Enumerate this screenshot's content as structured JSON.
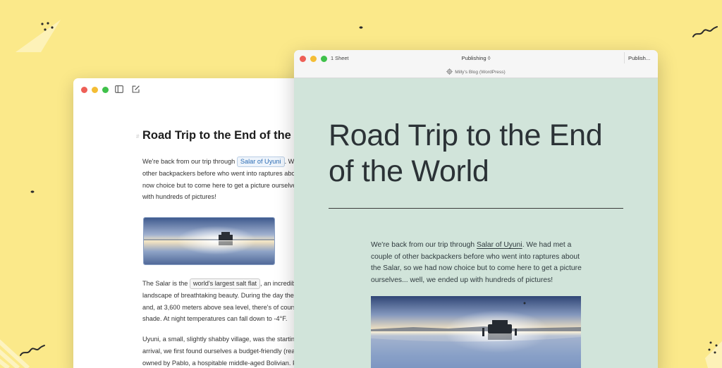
{
  "editor": {
    "title": "Road Trip to the End of the",
    "heading_marker": "#",
    "p1": {
      "pre": "We're back from our trip through ",
      "link": "Salar of Uyuni",
      "post": ". We",
      "line2": "other backpackers before who went into raptures abo",
      "line3": "now choice but to come here to get a picture ourselve",
      "line4": "with hundreds of pictures!"
    },
    "p2": {
      "pre": "The Salar is the ",
      "chip": "world's largest salt flat",
      "post": ", an incredib",
      "line2": "landscape of breathtaking beauty. During the day the",
      "line3": "and, at 3,600 meters above sea level, there's of cours",
      "line4": "shade. At night temperatures can fall down to -4°F."
    },
    "p3": {
      "line1": "Uyuni, a small, slightly shabby village, was the starting",
      "line2": "arrival, we first found ourselves a budget-friendly (rea",
      "line3": "owned by Pablo, a hospitable middle-aged Bolivian. P"
    }
  },
  "preview": {
    "sheets_label": "1 Sheet",
    "mode_label": "Publishing ◊",
    "publish_label": "Publish...",
    "blog_label": "Milly's Blog (WordPress)",
    "title": "Road Trip to the End of the World",
    "body": {
      "pre": "We're back from our trip through ",
      "link": "Salar of Uyuni",
      "post": ". We had met a couple of other backpackers before who went into raptures about the Salar, so we had now choice but to come here to get a picture ourselves... well, we ended up with hundreds of pictures!"
    }
  },
  "icons": {
    "sidebar": "sidebar-toggle-icon",
    "compose": "compose-icon",
    "gear": "gear-icon"
  },
  "colors": {
    "background": "#fbe98a",
    "preview_bg": "#d1e4da",
    "link_blue": "#2e6eb5"
  }
}
